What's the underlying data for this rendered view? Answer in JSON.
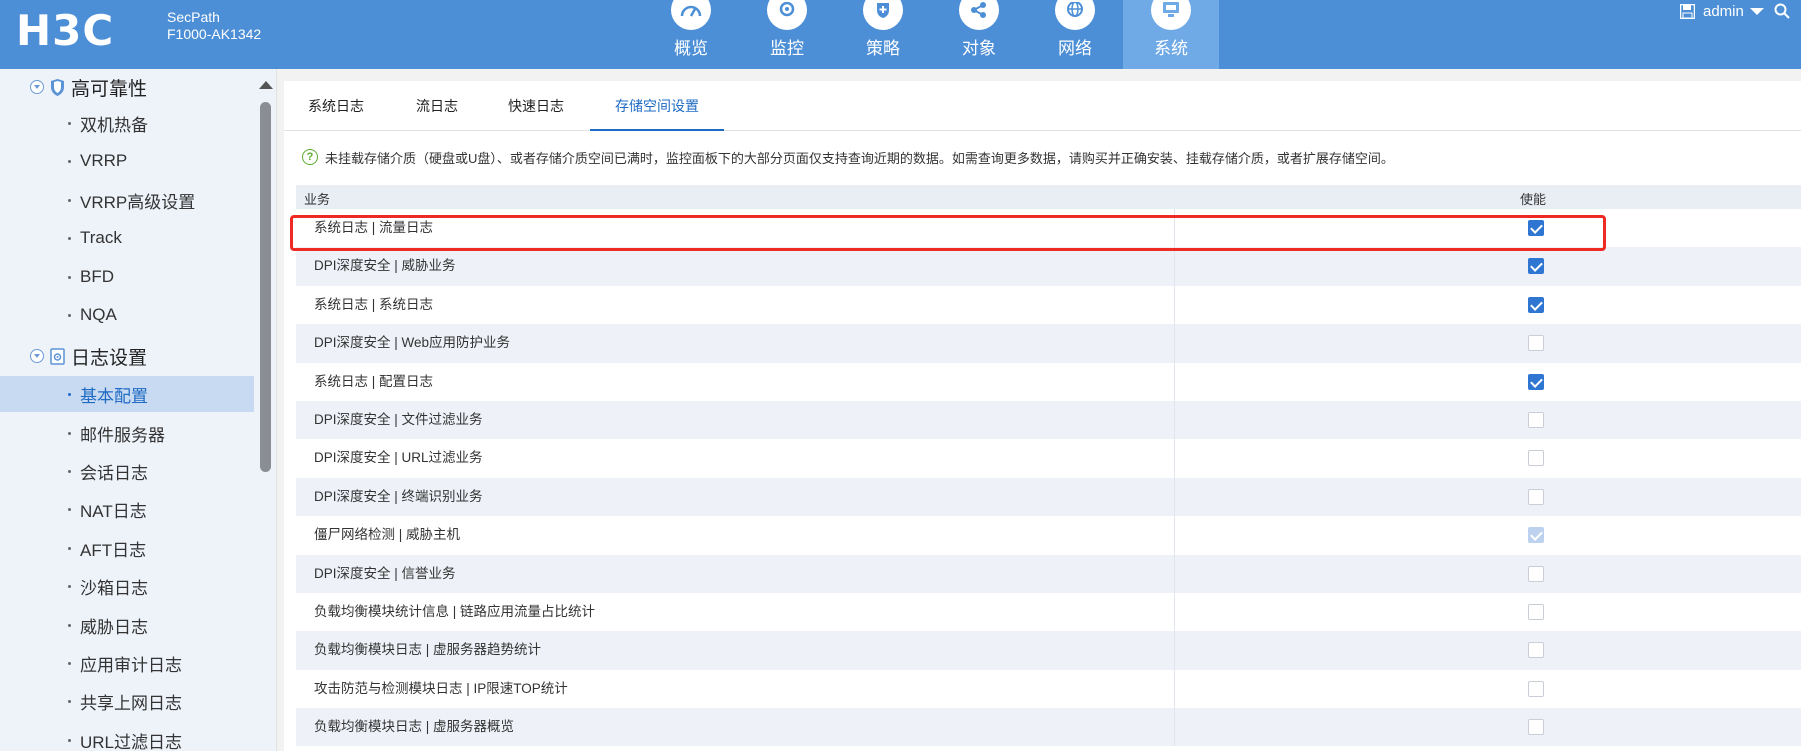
{
  "header": {
    "brand": "H3C",
    "model_line1": "SecPath",
    "model_line2": "F1000-AK1342",
    "nav": [
      {
        "label": "概览",
        "icon": "dashboard-icon",
        "active": false
      },
      {
        "label": "监控",
        "icon": "monitor-camera-icon",
        "active": false
      },
      {
        "label": "策略",
        "icon": "shield-plus-icon",
        "active": false
      },
      {
        "label": "对象",
        "icon": "share-nodes-icon",
        "active": false
      },
      {
        "label": "网络",
        "icon": "globe-icon",
        "active": false
      },
      {
        "label": "系统",
        "icon": "computer-icon",
        "active": true
      }
    ],
    "user": "admin"
  },
  "sidebar": {
    "sections": [
      {
        "label": "高可靠性",
        "icon": "shield-icon"
      },
      {
        "label": "日志设置",
        "icon": "log-settings-icon"
      }
    ],
    "items_ha": [
      "双机热备",
      "VRRP",
      "VRRP高级设置",
      "Track",
      "BFD",
      "NQA"
    ],
    "items_log": [
      "基本配置",
      "邮件服务器",
      "会话日志",
      "NAT日志",
      "AFT日志",
      "沙箱日志",
      "威胁日志",
      "应用审计日志",
      "共享上网日志",
      "URL过滤日志"
    ],
    "active_item": "基本配置"
  },
  "tabs": [
    "系统日志",
    "流日志",
    "快速日志",
    "存储空间设置"
  ],
  "active_tab": "存储空间设置",
  "notice": "未挂载存储介质（硬盘或U盘）、或者存储介质空间已满时，监控面板下的大部分页面仅支持查询近期的数据。如需查询更多数据，请购买并正确安装、挂载存储介质，或者扩展存储空间。",
  "table": {
    "headers": {
      "business": "业务",
      "enable": "使能"
    },
    "rows": [
      {
        "name": "系统日志 | 流量日志",
        "checked": true,
        "disabled": false
      },
      {
        "name": "DPI深度安全 | 威胁业务",
        "checked": true,
        "disabled": false
      },
      {
        "name": "系统日志 | 系统日志",
        "checked": true,
        "disabled": false
      },
      {
        "name": "DPI深度安全 | Web应用防护业务",
        "checked": false,
        "disabled": false
      },
      {
        "name": "系统日志 | 配置日志",
        "checked": true,
        "disabled": false
      },
      {
        "name": "DPI深度安全 | 文件过滤业务",
        "checked": false,
        "disabled": false
      },
      {
        "name": "DPI深度安全 | URL过滤业务",
        "checked": false,
        "disabled": false
      },
      {
        "name": "DPI深度安全 | 终端识别业务",
        "checked": false,
        "disabled": false
      },
      {
        "name": "僵尸网络检测 | 威胁主机",
        "checked": true,
        "disabled": true
      },
      {
        "name": "DPI深度安全 | 信誉业务",
        "checked": false,
        "disabled": false
      },
      {
        "name": "负载均衡模块统计信息 | 链路应用流量占比统计",
        "checked": false,
        "disabled": false
      },
      {
        "name": "负载均衡模块日志 | 虚服务器趋势统计",
        "checked": false,
        "disabled": false
      },
      {
        "name": "攻击防范与检测模块日志 | IP限速TOP统计",
        "checked": false,
        "disabled": false
      },
      {
        "name": "负载均衡模块日志 | 虚服务器概览",
        "checked": false,
        "disabled": false
      }
    ]
  },
  "colors": {
    "header_bg": "#4d8fd6",
    "nav_active_bg": "#6fa9e6",
    "accent": "#1f6bc4",
    "checkbox_checked": "#2f75d2",
    "highlight_border": "#ee2a24"
  }
}
